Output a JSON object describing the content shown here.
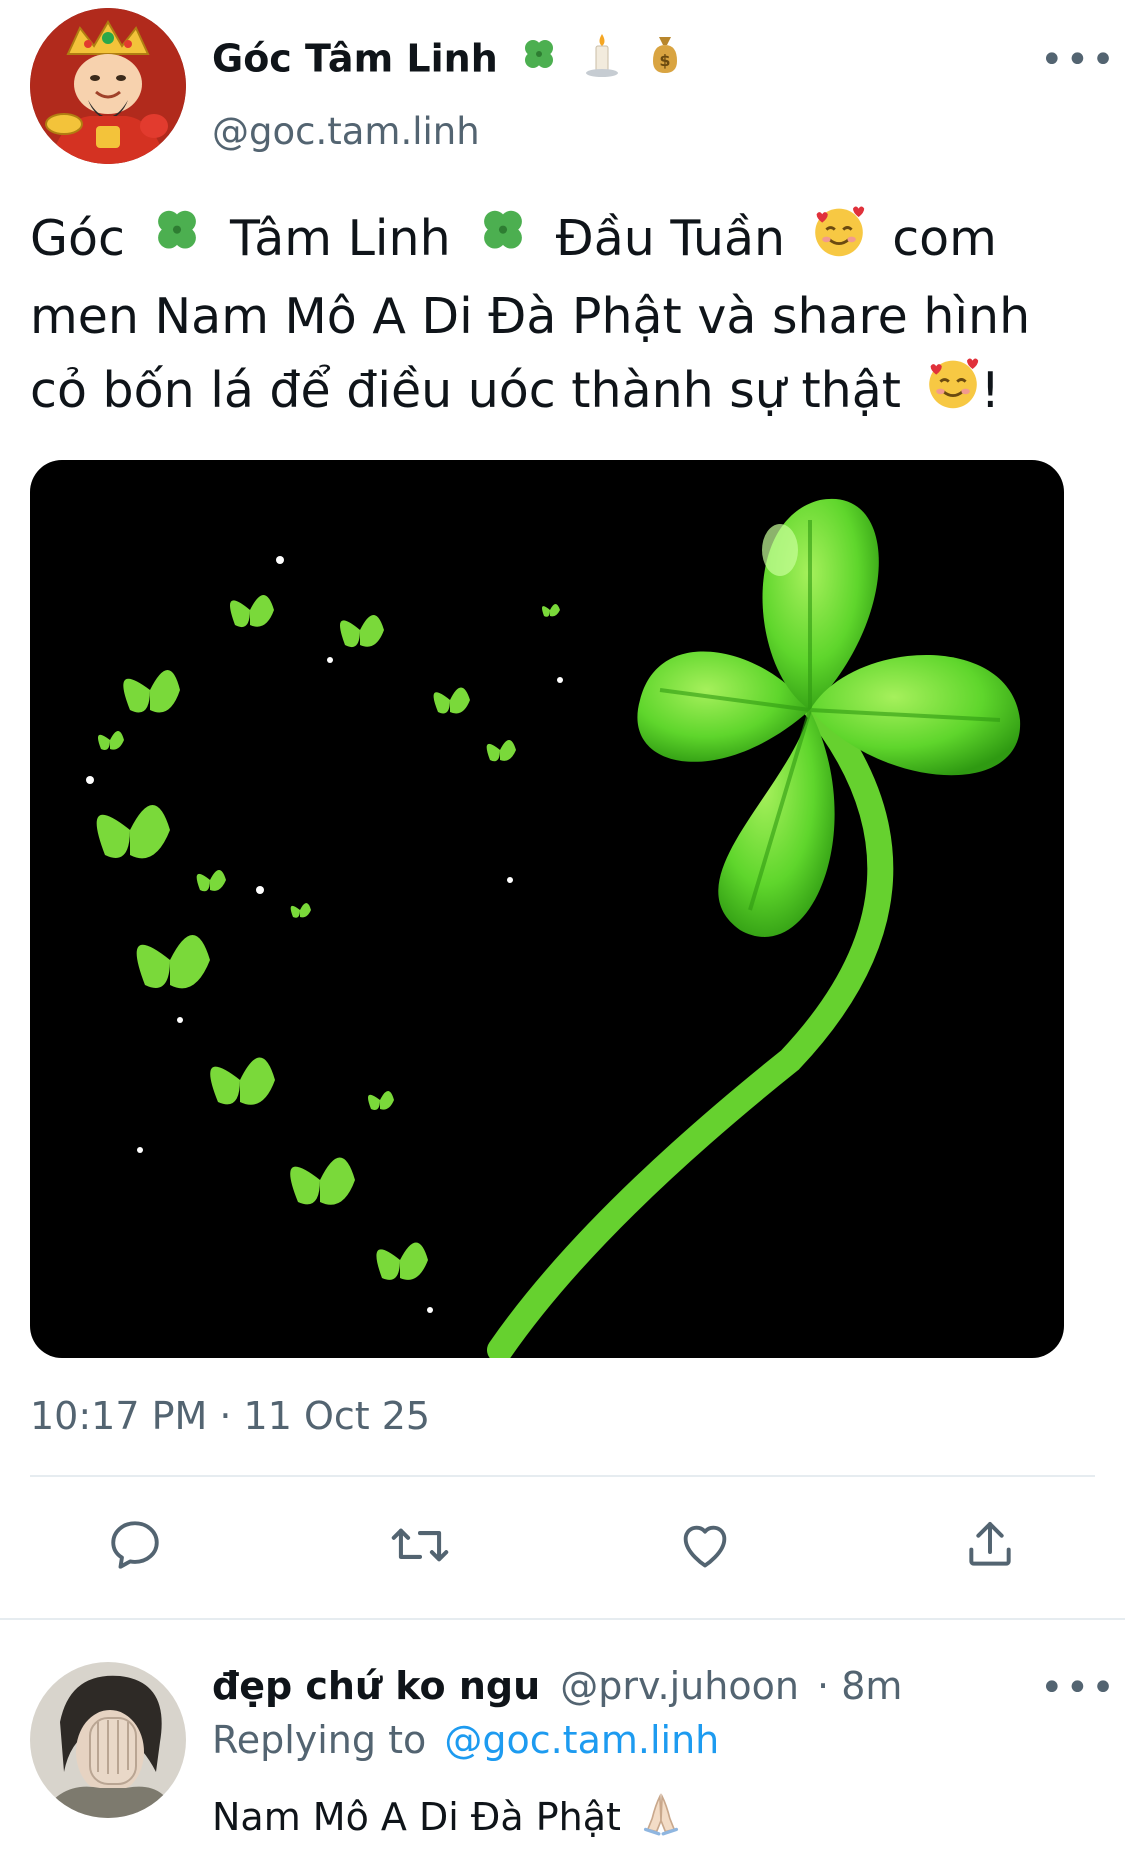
{
  "tweet": {
    "author_name": "Góc Tâm Linh",
    "author_name_emojis": [
      "🍀",
      "🕯",
      "💰"
    ],
    "author_handle": "@goc.tam.linh",
    "more_label": "•••",
    "text_line1_a": "Góc",
    "text_line1_b": "Tâm Linh",
    "text_line1_c": "Đầu Tuần",
    "text_line1_d": "com",
    "text_line2": "men Nam Mô A Di Đà Phật và share hình",
    "text_line3": "cỏ bốn lá để điều uóc thành sự thật",
    "text_line3_end": "!",
    "timestamp": "10:17 PM · 11 Oct 25",
    "image_icon": "four-leaf-clover-heart-butterflies"
  },
  "actions": {
    "reply_icon": "speech-bubble-icon",
    "retweet_icon": "retweet-icon",
    "like_icon": "heart-icon",
    "share_icon": "share-icon"
  },
  "reply": {
    "author_name": "đẹp chứ ko ngu",
    "author_handle": "@prv.juhoon",
    "time": "· 8m",
    "replying_prefix": "Replying to",
    "replying_to": "@goc.tam.linh",
    "text": "Nam Mô A Di Đà Phật",
    "text_emoji": "🙏🏻",
    "more_label": "•••"
  },
  "colors": {
    "text": "#0f1419",
    "muted": "#536471",
    "link": "#1d9bf0",
    "clover_green": "#5fd62c",
    "divider": "#e6ecf0"
  }
}
